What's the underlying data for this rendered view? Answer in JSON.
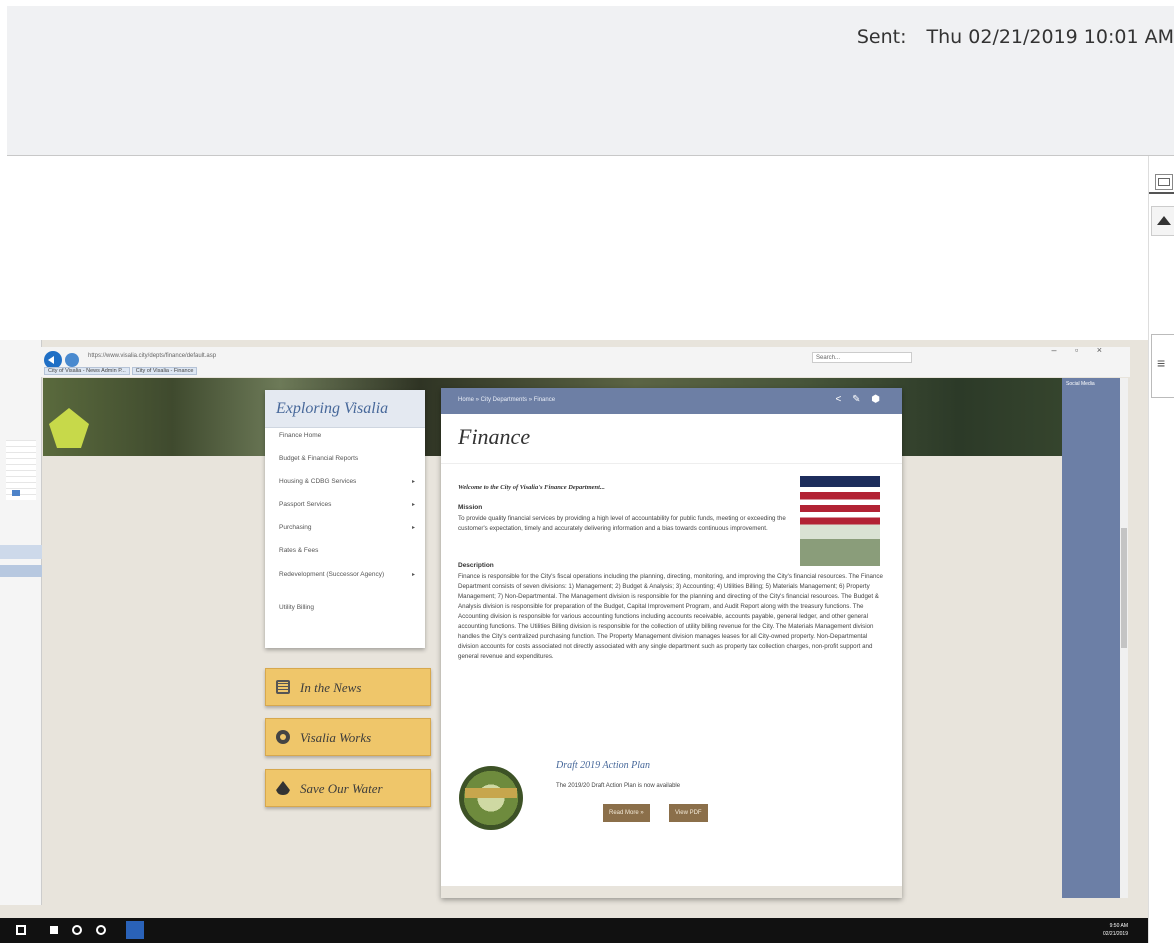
{
  "email": {
    "sent_label": "Sent:",
    "sent_value": "Thu 02/21/2019 10:01 AM"
  },
  "browser": {
    "url": "https://www.visalia.city/depts/finance/default.asp",
    "search_placeholder": "Search...",
    "tabs": [
      "City of Visalia - News Admin P...",
      "City of Visalia - Finance"
    ]
  },
  "site": {
    "social_media_label": "Social Media",
    "menu": {
      "title": "Exploring Visalia",
      "items": [
        {
          "label": "Finance Home",
          "has_arrow": false
        },
        {
          "label": "Budget & Financial Reports",
          "has_arrow": false
        },
        {
          "label": "Housing & CDBG Services",
          "has_arrow": true
        },
        {
          "label": "Passport Services",
          "has_arrow": true
        },
        {
          "label": "Purchasing",
          "has_arrow": true
        },
        {
          "label": "Rates & Fees",
          "has_arrow": false
        },
        {
          "label": "Redevelopment (Successor Agency)",
          "has_arrow": true
        },
        {
          "label": "Utility Billing",
          "has_arrow": false
        }
      ]
    },
    "promos": [
      {
        "label": "In the News",
        "icon": "newspaper-icon"
      },
      {
        "label": "Visalia Works",
        "icon": "gear-icon"
      },
      {
        "label": "Save Our Water",
        "icon": "water-drop-icon"
      }
    ],
    "content": {
      "breadcrumb": "Home  »  City Departments  »  Finance",
      "page_title": "Finance",
      "welcome": "Welcome to the City of Visalia's Finance Department...",
      "mission_heading": "Mission",
      "mission_text": "To provide quality financial services by providing a high level of accountability for public funds, meeting or exceeding the customer's expectation, timely and accurately delivering information and a bias towards continuous improvement.",
      "description_heading": "Description",
      "description_text": "Finance is responsible for the City's fiscal operations including the planning, directing, monitoring, and improving the City's financial resources. The Finance Department consists of seven divisions: 1) Management; 2) Budget & Analysis; 3) Accounting; 4) Utilities Billing; 5) Materials Management; 6) Property Management; 7) Non-Departmental. The Management division is responsible for the planning and directing of the City's financial resources. The Budget & Analysis division is responsible for preparation of the Budget, Capital Improvement Program, and Audit Report along with the treasury functions. The Accounting division is responsible for various accounting functions including accounts receivable, accounts payable, general ledger, and other general accounting functions. The Utilities Billing division is responsible for the collection of utility billing revenue for the City. The Materials Management division handles the City's centralized purchasing function. The Property Management division manages leases for all City-owned property. Non-Departmental division accounts for costs associated not directly associated with any single department such as property tax collection charges, non-profit support and general revenue and expenditures.",
      "plan_title": "Draft 2019 Action Plan",
      "plan_subtitle": "The 2019/20 Draft Action Plan is now available",
      "read_more_label": "Read More »",
      "view_pdf_label": "View PDF"
    }
  },
  "taskbar": {
    "clock_time": "9:50 AM",
    "clock_date": "02/21/2019"
  }
}
